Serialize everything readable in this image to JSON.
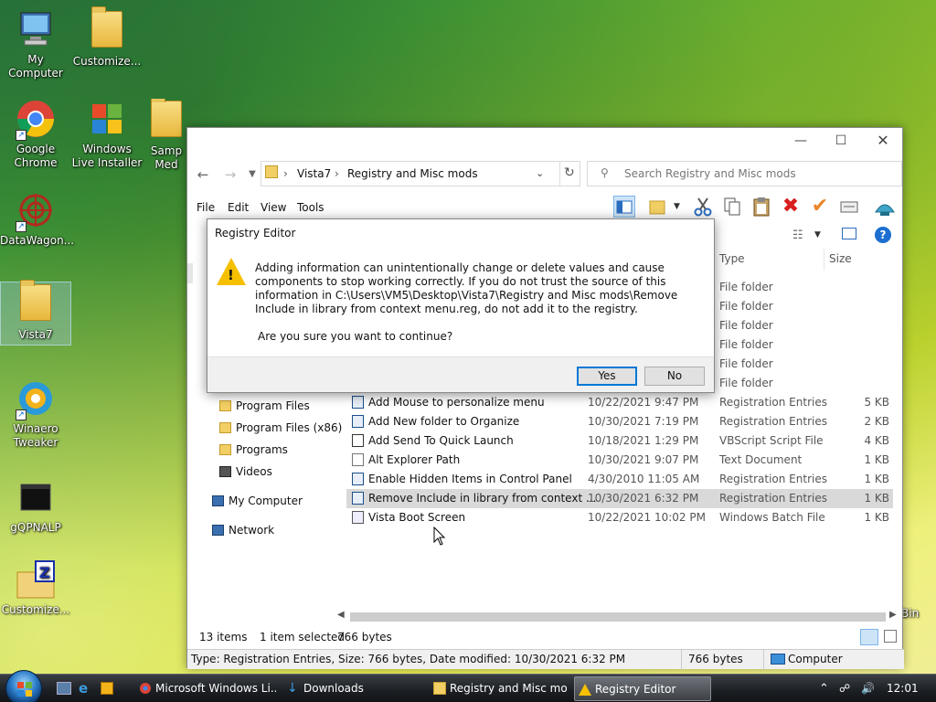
{
  "desktop": {
    "icons": [
      {
        "label": "My Computer"
      },
      {
        "label": "Customize..."
      },
      {
        "label": "Google Chrome"
      },
      {
        "label": "Windows Live Installer"
      },
      {
        "label": "Samp Med"
      },
      {
        "label": "DataWagon..."
      },
      {
        "label": "Vista7"
      },
      {
        "label": "Winaero Tweaker"
      },
      {
        "label": "gQPNALP"
      },
      {
        "label": "Customize..."
      },
      {
        "label": "Bin"
      }
    ]
  },
  "explorer": {
    "address": {
      "root": "Vista7",
      "current": "Registry and Misc mods"
    },
    "search_placeholder": "Search Registry and Misc mods",
    "menu": [
      "File",
      "Edit",
      "View",
      "Tools"
    ],
    "columns": {
      "type": "Type",
      "size": "Size"
    },
    "folder_rows": [
      "File folder",
      "File folder",
      "File folder",
      "File folder",
      "File folder",
      "File folder"
    ],
    "nav": [
      {
        "label": "Program Files"
      },
      {
        "label": "Program Files (x86)"
      },
      {
        "label": "Programs"
      },
      {
        "label": "Videos"
      },
      {
        "label": "My Computer"
      },
      {
        "label": "Network"
      }
    ],
    "files": [
      {
        "name": "Add Mouse to personalize menu",
        "date": "10/22/2021 9:47 PM",
        "type": "Registration Entries",
        "size": "5 KB"
      },
      {
        "name": "Add New folder to Organize",
        "date": "10/30/2021 7:19 PM",
        "type": "Registration Entries",
        "size": "2 KB"
      },
      {
        "name": "Add Send To Quick Launch",
        "date": "10/18/2021 1:29 PM",
        "type": "VBScript Script File",
        "size": "4 KB"
      },
      {
        "name": "Alt Explorer Path",
        "date": "10/30/2021 9:07 PM",
        "type": "Text Document",
        "size": "1 KB"
      },
      {
        "name": "Enable Hidden Items in Control Panel",
        "date": "4/30/2010 11:05 AM",
        "type": "Registration Entries",
        "size": "1 KB"
      },
      {
        "name": "Remove Include in library from context ...",
        "date": "10/30/2021 6:32 PM",
        "type": "Registration Entries",
        "size": "1 KB"
      },
      {
        "name": "Vista Boot Screen",
        "date": "10/22/2021 10:02 PM",
        "type": "Windows Batch File",
        "size": "1 KB"
      }
    ],
    "status": {
      "items": "13 items",
      "selected": "1 item selected",
      "bytes": "766 bytes"
    },
    "details": {
      "text": "Type: Registration Entries, Size: 766 bytes, Date modified: 10/30/2021 6:32 PM",
      "size": "766 bytes",
      "location": "Computer"
    }
  },
  "dialog": {
    "title": "Registry Editor",
    "message": "Adding information can unintentionally change or delete values and cause components to stop working correctly. If you do not trust the source of this information in C:\\Users\\VM5\\Desktop\\Vista7\\Registry and Misc mods\\Remove Include in library from context menu.reg, do not add it to the registry.",
    "question": "Are you sure you want to continue?",
    "yes": "Yes",
    "no": "No"
  },
  "taskbar": {
    "items": [
      {
        "label": "Microsoft Windows Li..."
      },
      {
        "label": "Downloads"
      },
      {
        "label": "Registry and Misc mo..."
      },
      {
        "label": "Registry Editor"
      }
    ],
    "clock": "12:01 AM"
  },
  "colors": {
    "accent": "#0078d7",
    "selection": "#d9d9d9",
    "warning": "#f6c000"
  }
}
